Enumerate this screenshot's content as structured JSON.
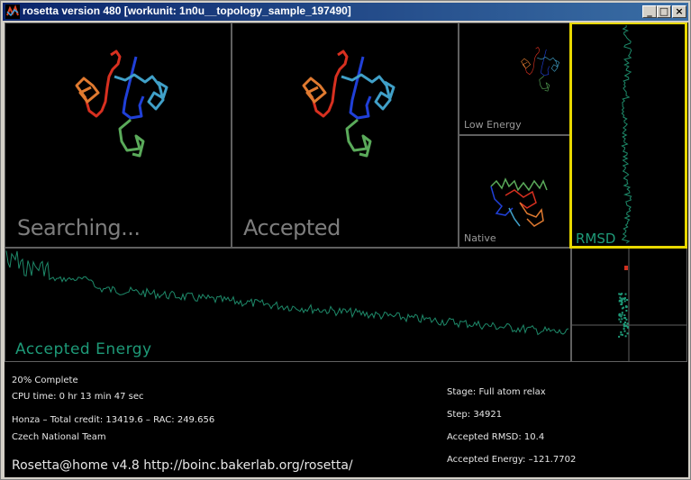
{
  "window": {
    "title": "rosetta version 480 [workunit: 1n0u__topology_sample_197490]",
    "controls": {
      "minimize": "_",
      "maximize": "□",
      "close": "×"
    }
  },
  "panels": {
    "searching": {
      "label": "Searching..."
    },
    "accepted": {
      "label": "Accepted"
    },
    "low_energy": {
      "label": "Low  Energy"
    },
    "native": {
      "label": "Native"
    },
    "rmsd": {
      "label": "RMSD"
    },
    "accepted_energy": {
      "label": "Accepted  Energy"
    }
  },
  "status": {
    "complete": "20%  Complete",
    "cpu_time": "CPU  time:  0  hr  13  min  47  sec",
    "user": "Honza  –  Total  credit:  13419.6  –  RAC:  249.656",
    "team": "Czech  National  Team",
    "stage": "Stage:  Full  atom  relax",
    "step": "Step:  34921",
    "accepted_rmsd": "Accepted  RMSD:    10.4",
    "accepted_energy": "Accepted  Energy:  –121.7702",
    "footer": "Rosetta@home   v4.8   http://boinc.bakerlab.org/rosetta/"
  },
  "colors": {
    "background": "#000000",
    "panel_border": "#606060",
    "highlight": "#e8d800",
    "plot_line": "#1e8a6a",
    "marker": "#d03020"
  }
}
